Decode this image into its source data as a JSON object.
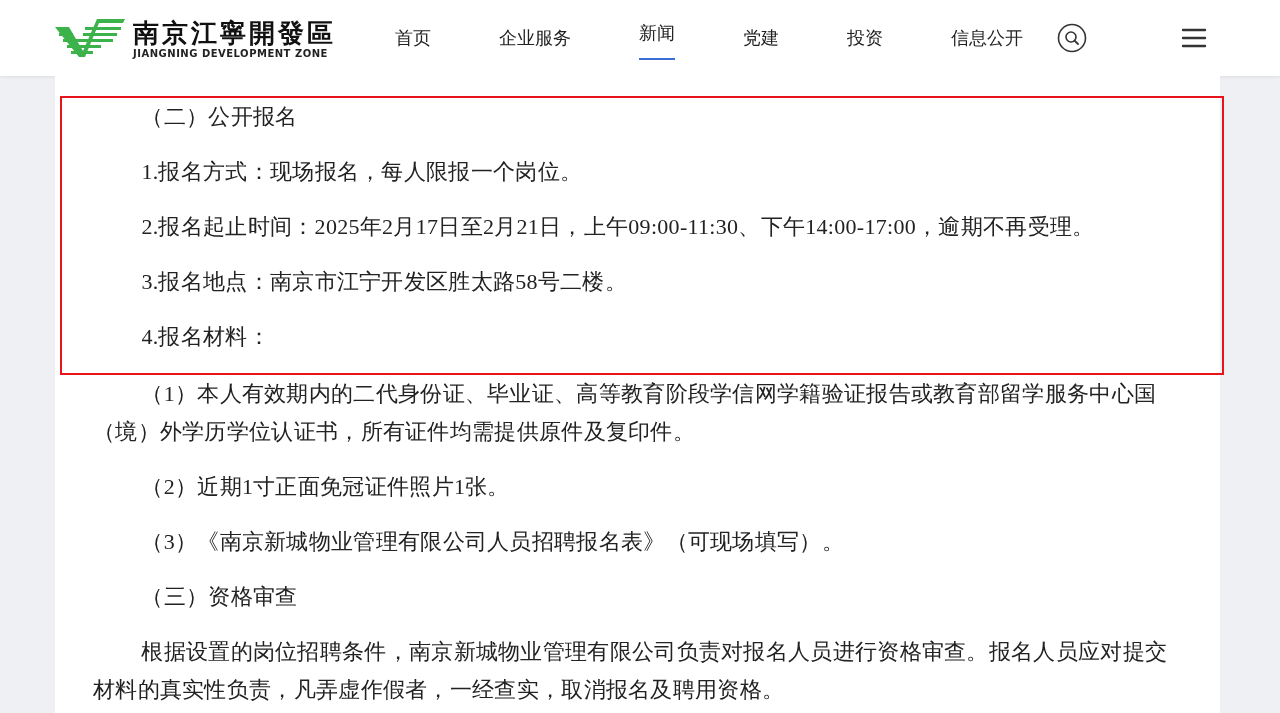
{
  "header": {
    "logo": {
      "name": "南京江寧開發區",
      "subtitle": "JIANGNING DEVELOPMENT ZONE"
    },
    "nav": [
      {
        "label": "首页",
        "selected": false
      },
      {
        "label": "企业服务",
        "selected": false
      },
      {
        "label": "新闻",
        "selected": true
      },
      {
        "label": "党建",
        "selected": false
      },
      {
        "label": "投资",
        "selected": false
      },
      {
        "label": "信息公开",
        "selected": false
      }
    ]
  },
  "article": {
    "sections": [
      {
        "highlighted": true,
        "paragraphs": [
          "（二）公开报名",
          "1.报名方式：现场报名，每人限报一个岗位。",
          "2.报名起止时间：2025年2月17日至2月21日，上午09:00-11:30、下午14:00-17:00，逾期不再受理。",
          "3.报名地点：南京市江宁开发区胜太路58号二楼。",
          "4.报名材料："
        ]
      },
      {
        "highlighted": false,
        "paragraphs": [
          "（1）本人有效期内的二代身份证、毕业证、高等教育阶段学信网学籍验证报告或教育部留学服务中心国（境）外学历学位认证书，所有证件均需提供原件及复印件。",
          "（2）近期1寸正面免冠证件照片1张。",
          "（3）《南京新城物业管理有限公司人员招聘报名表》（可现场填写）。",
          "（三）资格审查",
          "根据设置的岗位招聘条件，南京新城物业管理有限公司负责对报名人员进行资格审查。报名人员应对提交材料的真实性负责，凡弄虚作假者，一经查实，取消报名及聘用资格。"
        ]
      }
    ]
  }
}
